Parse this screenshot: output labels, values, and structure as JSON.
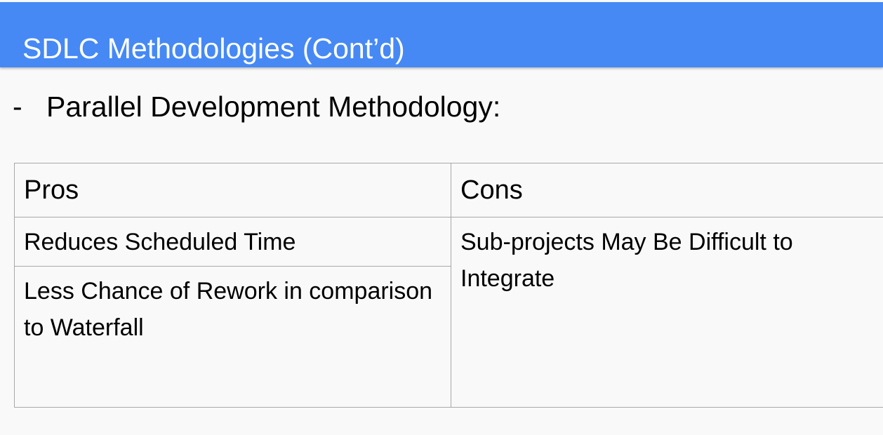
{
  "slide": {
    "title": "SDLC Methodologies (Cont’d)",
    "bullet_marker": "-",
    "bullet_text": "Parallel Development Methodology:"
  },
  "table": {
    "headers": {
      "pros": "Pros",
      "cons": "Cons"
    },
    "pros": [
      "Reduces Scheduled Time",
      "Less Chance of Rework in comparison to Waterfall"
    ],
    "cons": [
      "Sub-projects May Be Difficult to Integrate"
    ]
  },
  "colors": {
    "title_bar": "#4689f5",
    "title_text": "#ffffff",
    "background": "#f9f9f9",
    "table_border": "#a8a8a8"
  }
}
